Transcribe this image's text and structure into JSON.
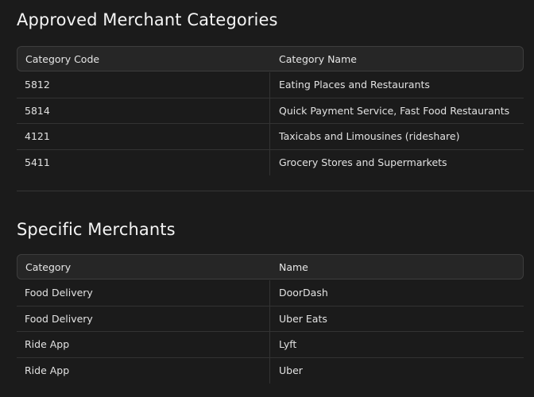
{
  "merchant_categories": {
    "title": "Approved Merchant Categories",
    "headers": [
      "Category Code",
      "Category Name"
    ],
    "rows": [
      [
        "5812",
        "Eating Places and Restaurants"
      ],
      [
        "5814",
        "Quick Payment Service, Fast Food Restaurants"
      ],
      [
        "4121",
        "Taxicabs and Limousines (rideshare)"
      ],
      [
        "5411",
        "Grocery Stores and Supermarkets"
      ]
    ]
  },
  "specific_merchants": {
    "title": "Specific Merchants",
    "headers": [
      "Category",
      "Name"
    ],
    "rows": [
      [
        "Food Delivery",
        "DoorDash"
      ],
      [
        "Food Delivery",
        "Uber Eats"
      ],
      [
        "Ride App",
        "Lyft"
      ],
      [
        "Ride App",
        "Uber"
      ]
    ]
  }
}
